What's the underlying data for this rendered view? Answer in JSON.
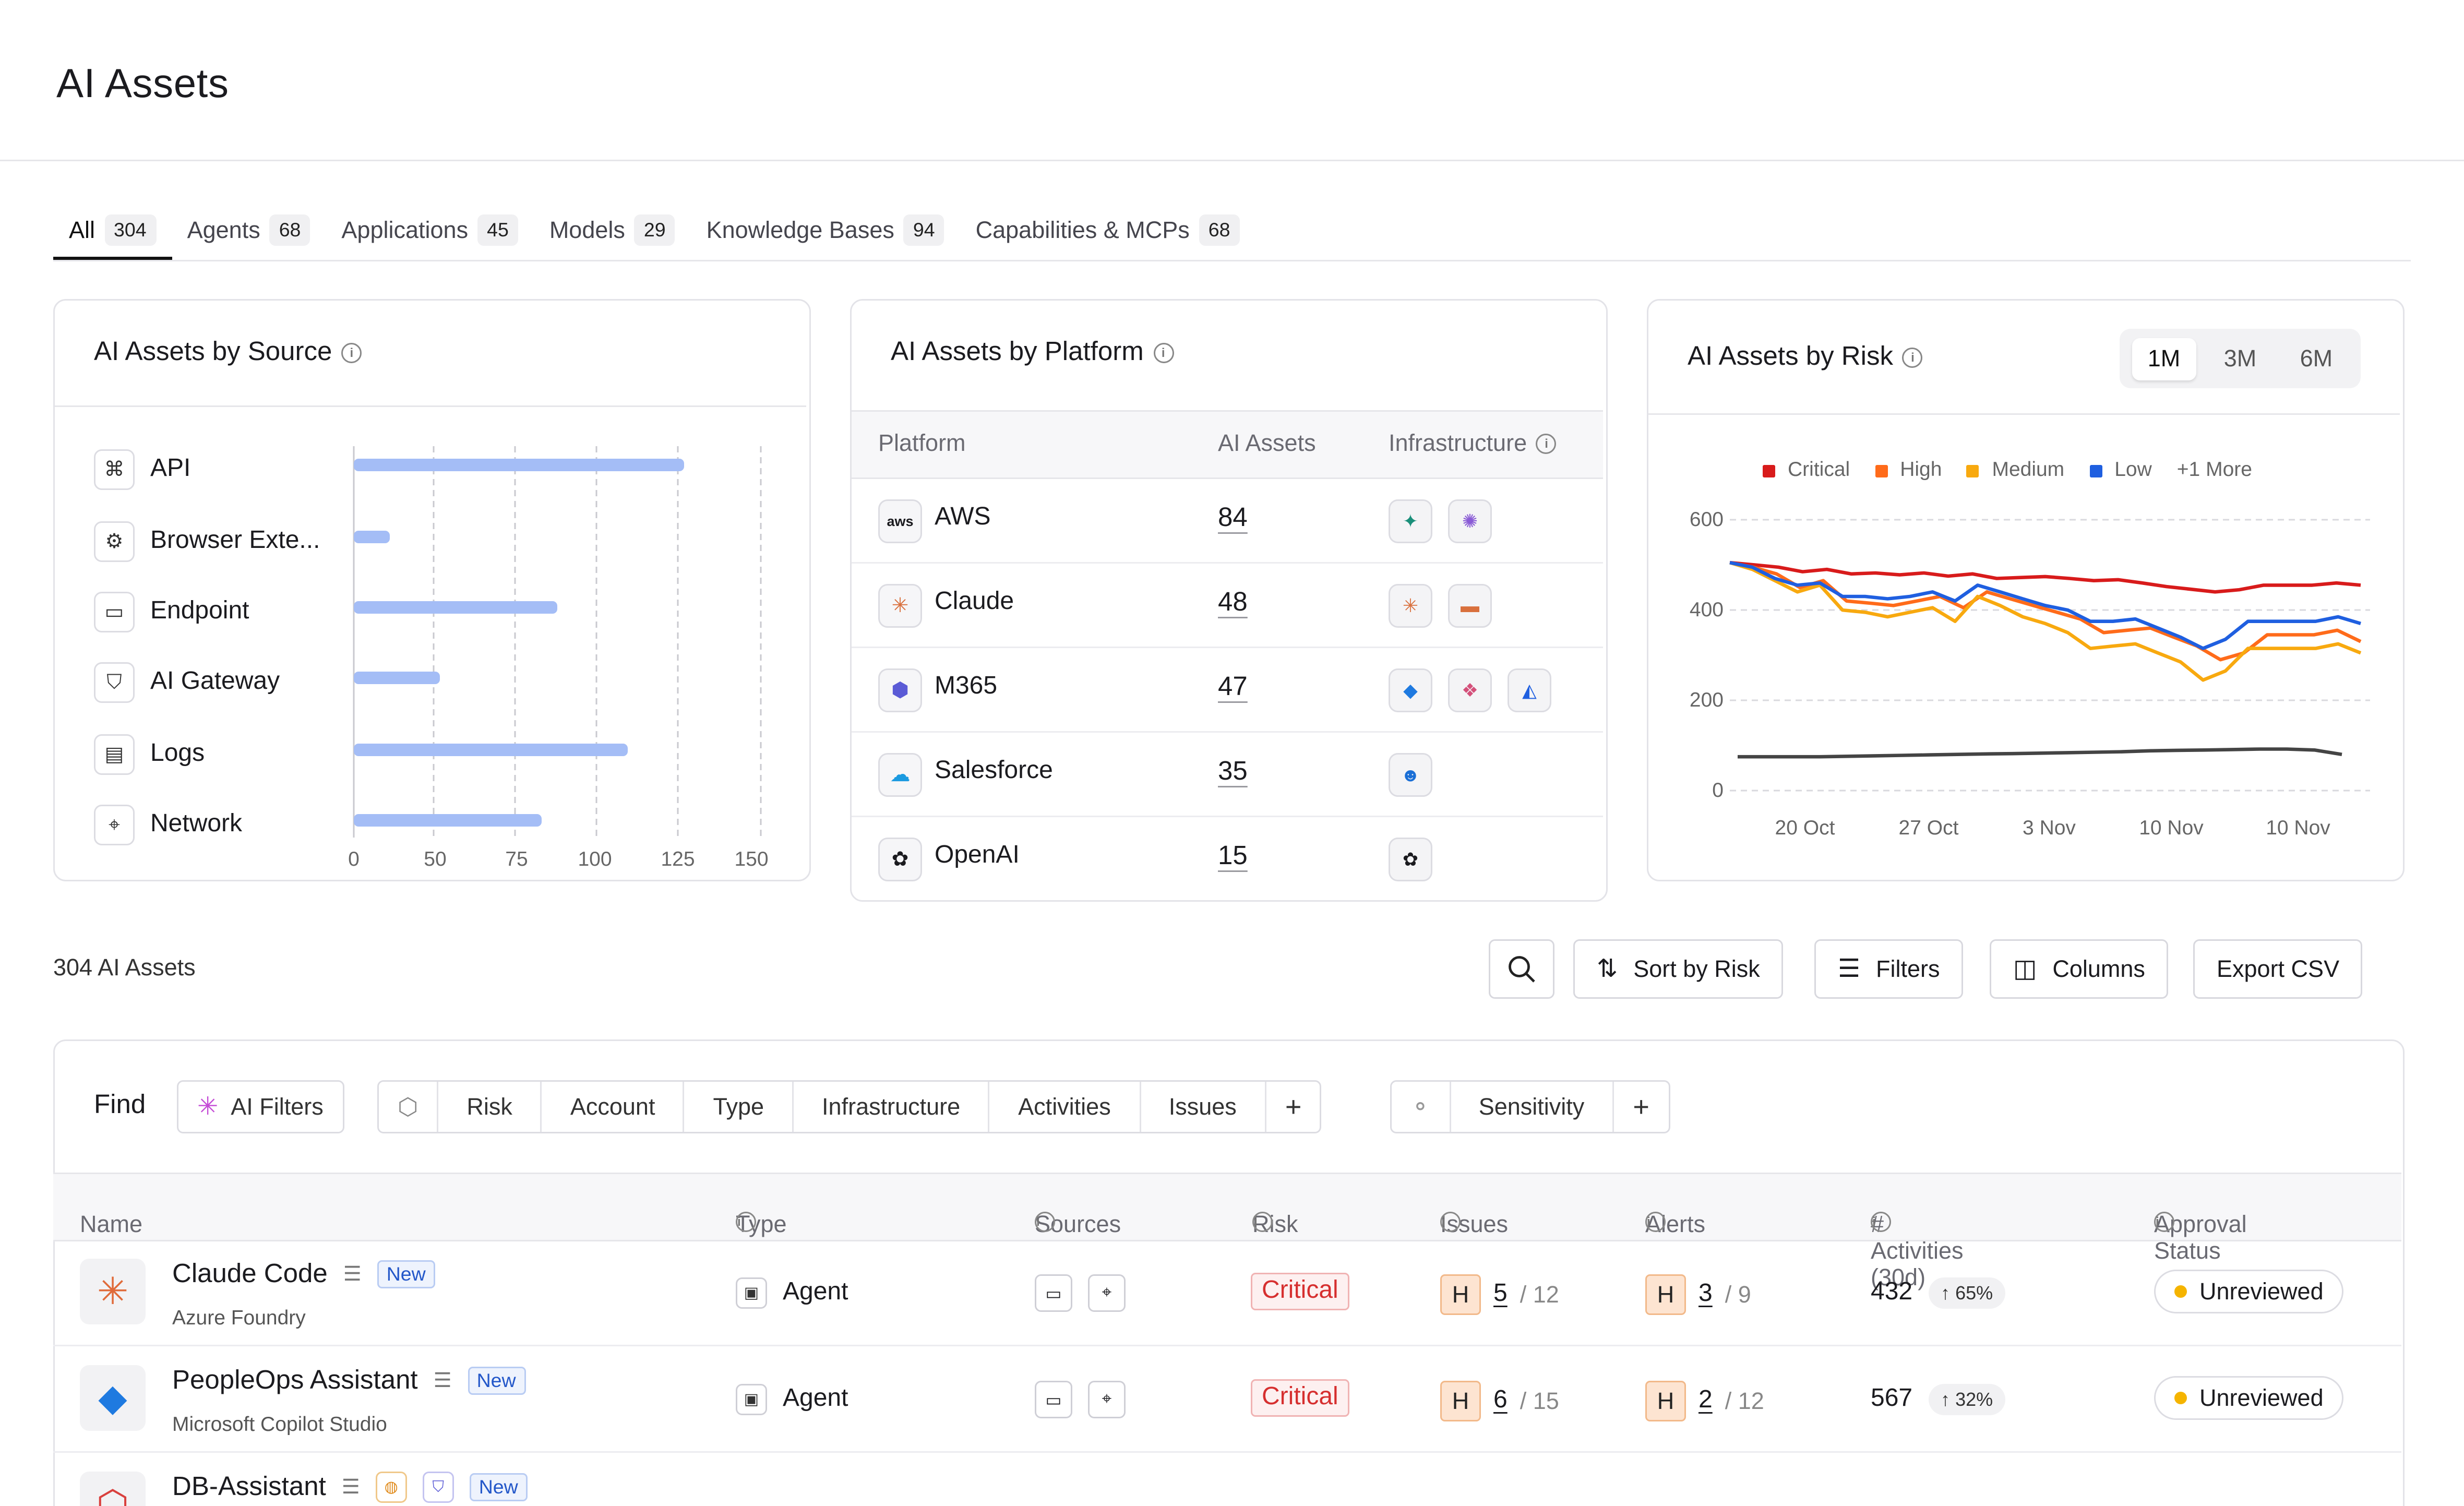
{
  "page": {
    "title": "AI Assets"
  },
  "tabs": [
    {
      "label": "All",
      "count": "304"
    },
    {
      "label": "Agents",
      "count": "68"
    },
    {
      "label": "Applications",
      "count": "45"
    },
    {
      "label": "Models",
      "count": "29"
    },
    {
      "label": "Knowledge Bases",
      "count": "94"
    },
    {
      "label": "Capabilities & MCPs",
      "count": "68"
    }
  ],
  "source_card": {
    "title": "AI Assets by Source",
    "items": [
      {
        "label": "API",
        "icon": "api-icon",
        "value": 127
      },
      {
        "label": "Browser Exte...",
        "icon": "gear-icon",
        "value": 14
      },
      {
        "label": "Endpoint",
        "icon": "monitor-icon",
        "value": 78
      },
      {
        "label": "AI Gateway",
        "icon": "shield-icon",
        "value": 33
      },
      {
        "label": "Logs",
        "icon": "document-icon",
        "value": 105
      },
      {
        "label": "Network",
        "icon": "network-icon",
        "value": 72
      }
    ],
    "ticks": [
      "0",
      "50",
      "75",
      "100",
      "125",
      "150"
    ]
  },
  "platform_card": {
    "title": "AI Assets by Platform",
    "columns": [
      "Platform",
      "AI Assets",
      "Infrastructure"
    ],
    "rows": [
      {
        "name": "AWS",
        "count": "84",
        "icon": "aws-icon",
        "infra": [
          "bedrock-icon",
          "brain-icon"
        ]
      },
      {
        "name": "Claude",
        "count": "48",
        "icon": "claude-icon",
        "infra": [
          "claude-icon",
          "sofa-icon"
        ]
      },
      {
        "name": "M365",
        "count": "47",
        "icon": "m365-icon",
        "infra": [
          "copilot-studio-icon",
          "copilot-icon",
          "azure-icon"
        ]
      },
      {
        "name": "Salesforce",
        "count": "35",
        "icon": "salesforce-icon",
        "infra": [
          "einstein-icon"
        ]
      },
      {
        "name": "OpenAI",
        "count": "15",
        "icon": "openai-icon",
        "infra": [
          "openai-icon"
        ]
      }
    ]
  },
  "risk_card": {
    "title": "AI Assets by Risk",
    "ranges": [
      "1M",
      "3M",
      "6M"
    ],
    "active_range": "1M",
    "legend": [
      {
        "label": "Critical",
        "color": "#d81b1b"
      },
      {
        "label": "High",
        "color": "#ff6b1a"
      },
      {
        "label": "Medium",
        "color": "#f8a90f"
      },
      {
        "label": "Low",
        "color": "#1f5fe0"
      }
    ],
    "more": "+1 More"
  },
  "chart_data": {
    "type": "line",
    "x": [
      "20 Oct",
      "27 Oct",
      "3 Nov",
      "10 Nov",
      "10 Nov"
    ],
    "yticks": [
      "0",
      "200",
      "400",
      "600"
    ],
    "ylim": [
      0,
      600
    ],
    "series": [
      {
        "name": "Critical",
        "color": "#d81b1b",
        "values": [
          505,
          500,
          495,
          485,
          490,
          480,
          482,
          478,
          482,
          475,
          480,
          470,
          472,
          474,
          470,
          465,
          467,
          460,
          452,
          446,
          440,
          445,
          455,
          455,
          455,
          460,
          455
        ]
      },
      {
        "name": "High",
        "color": "#ff6b1a",
        "values": [
          505,
          495,
          480,
          450,
          465,
          420,
          415,
          410,
          420,
          430,
          405,
          440,
          425,
          410,
          395,
          380,
          350,
          355,
          360,
          340,
          320,
          290,
          305,
          345,
          345,
          345,
          355,
          330
        ]
      },
      {
        "name": "Medium",
        "color": "#f8a90f",
        "values": [
          505,
          490,
          465,
          440,
          455,
          400,
          395,
          385,
          395,
          405,
          375,
          430,
          410,
          385,
          370,
          350,
          315,
          320,
          325,
          305,
          285,
          245,
          265,
          315,
          315,
          315,
          315,
          325,
          305
        ]
      },
      {
        "name": "Low",
        "color": "#1f5fe0",
        "values": [
          505,
          495,
          470,
          455,
          460,
          430,
          430,
          425,
          430,
          440,
          420,
          455,
          440,
          425,
          410,
          400,
          375,
          375,
          380,
          360,
          340,
          315,
          335,
          375,
          375,
          375,
          375,
          385,
          370
        ]
      },
      {
        "name": "Other",
        "color": "#444444",
        "values": [
          75,
          75,
          75,
          75,
          76,
          77,
          78,
          79,
          80,
          81,
          82,
          83,
          84,
          85,
          86,
          88,
          89,
          90,
          91,
          92,
          92,
          90,
          80
        ]
      }
    ]
  },
  "list": {
    "count_label": "304 AI Assets",
    "buttons": {
      "sort": "Sort by Risk",
      "filters": "Filters",
      "columns": "Columns",
      "export": "Export CSV"
    }
  },
  "find": {
    "label": "Find",
    "ai_filters": "AI Filters",
    "chips1": [
      "Risk",
      "Account",
      "Type",
      "Infrastructure",
      "Activities",
      "Issues"
    ],
    "chips2": [
      "Sensitivity"
    ]
  },
  "table": {
    "headers": [
      "Name",
      "Type",
      "Sources",
      "Risk",
      "Issues",
      "Alerts",
      "# Activities (30d)",
      "Approval Status"
    ],
    "rows": [
      {
        "name": "Claude Code",
        "sub": "Azure Foundry",
        "badge": "New",
        "type": "Agent",
        "risk": "Critical",
        "issue_sev": "H",
        "issues": "5",
        "issues_total": "/ 12",
        "alert_sev": "H",
        "alerts": "3",
        "alerts_total": "/ 9",
        "activities": "432",
        "trend": "65%",
        "status": "Unreviewed"
      },
      {
        "name": "PeopleOps Assistant",
        "sub": "Microsoft Copilot Studio",
        "badge": "New",
        "type": "Agent",
        "risk": "Critical",
        "issue_sev": "H",
        "issues": "6",
        "issues_total": "/ 15",
        "alert_sev": "H",
        "alerts": "2",
        "alerts_total": "/ 12",
        "activities": "567",
        "trend": "32%",
        "status": "Unreviewed"
      },
      {
        "name": "DB-Assistant",
        "badge": "New"
      }
    ]
  }
}
